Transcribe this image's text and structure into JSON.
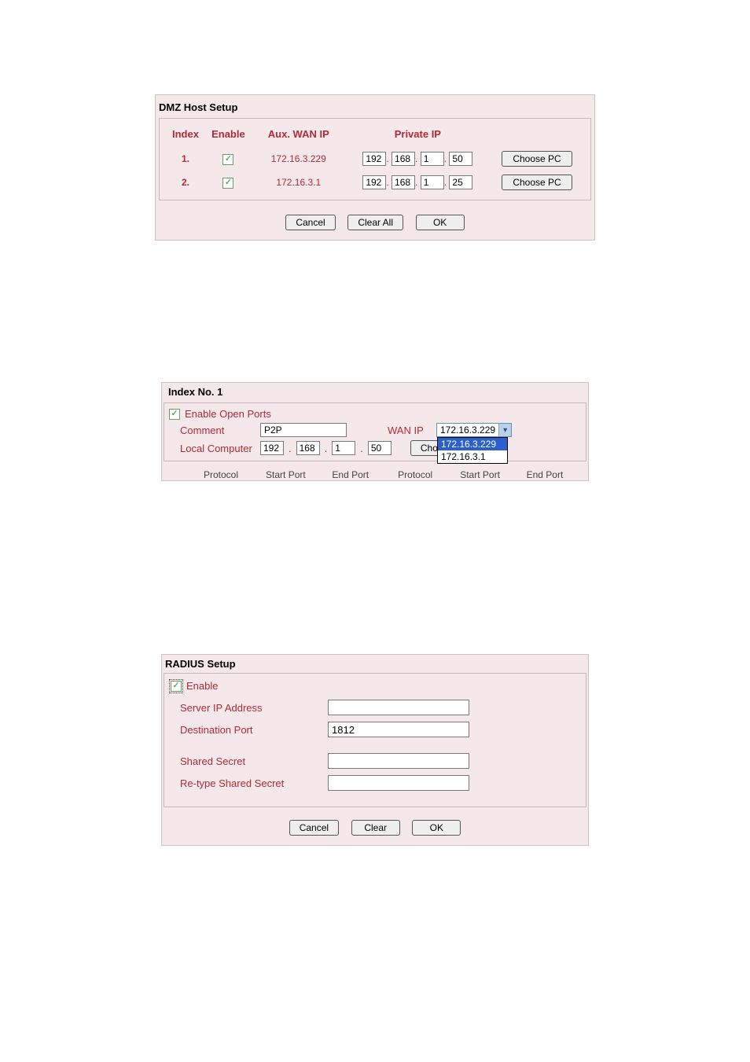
{
  "dmz": {
    "title": "DMZ Host Setup",
    "headers": {
      "index": "Index",
      "enable": "Enable",
      "auxwan": "Aux. WAN IP",
      "private": "Private IP"
    },
    "rows": [
      {
        "idx": "1.",
        "enabled": true,
        "auxwan": "172.16.3.229",
        "ip": [
          "192",
          "168",
          "1",
          "50"
        ]
      },
      {
        "idx": "2.",
        "enabled": true,
        "auxwan": "172.16.3.1",
        "ip": [
          "192",
          "168",
          "1",
          "25"
        ]
      }
    ],
    "choose_pc": "Choose PC",
    "buttons": {
      "cancel": "Cancel",
      "clear_all": "Clear All",
      "ok": "OK"
    }
  },
  "openports": {
    "title": "Index No. 1",
    "enable_label": "Enable Open Ports",
    "enable_checked": true,
    "comment_label": "Comment",
    "comment_value": "P2P",
    "wanip_label": "WAN IP",
    "wanip_selected": "172.16.3.229",
    "wanip_options": [
      "172.16.3.229",
      "172.16.3.1"
    ],
    "local_label": "Local Computer",
    "local_ip": [
      "192",
      "168",
      "1",
      "50"
    ],
    "choose_ip": "Choose IP",
    "port_headers": {
      "protocol": "Protocol",
      "start": "Start Port",
      "end": "End Port"
    }
  },
  "radius": {
    "title": "RADIUS Setup",
    "enable_label": "Enable",
    "enable_checked": true,
    "rows": {
      "server_ip_label": "Server IP Address",
      "server_ip_value": "",
      "dest_port_label": "Destination Port",
      "dest_port_value": "1812",
      "shared_label": "Shared Secret",
      "shared_value": "",
      "retype_label": "Re-type Shared Secret",
      "retype_value": ""
    },
    "buttons": {
      "cancel": "Cancel",
      "clear": "Clear",
      "ok": "OK"
    }
  }
}
